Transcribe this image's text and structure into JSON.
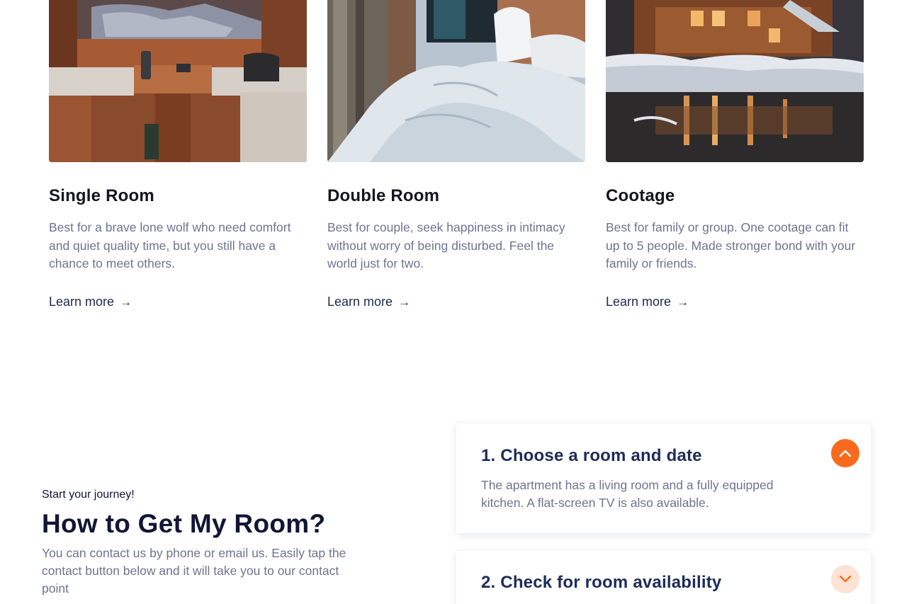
{
  "rooms": [
    {
      "title": "Single Room",
      "description": "Best for a brave lone wolf who need comfort and quiet quality time, but you still have a chance to meet others.",
      "link": "Learn more",
      "image_icon": "wooden-cabin-interior-photo"
    },
    {
      "title": "Double Room",
      "description": "Best for couple, seek happiness in intimacy without worry of being disturbed. Feel the world just for two.",
      "link": "Learn more",
      "image_icon": "white-bed-photo"
    },
    {
      "title": "Cootage",
      "description": "Best for family or group. One cootage can fit up to 5 people. Made stronger bond with your family or friends.",
      "link": "Learn more",
      "image_icon": "snowy-cottage-photo"
    }
  ],
  "journey": {
    "kicker": "Start your journey!",
    "title": "How to Get My Room?",
    "description": "You can contact us by phone or email us. Easily tap the contact button below and it will take you to our contact point"
  },
  "faq": [
    {
      "question": "1. Choose a room and date",
      "answer": "The apartment has a living room and a fully equipped kitchen. A flat-screen TV is also available.",
      "expanded": true,
      "icon": "chevron-up-icon"
    },
    {
      "question": "2. Check for room availability",
      "expanded": false,
      "icon": "chevron-down-icon"
    }
  ],
  "colors": {
    "accent": "#fb6a1c",
    "accent_light": "#fde3d4",
    "heading": "#111634",
    "body_text": "#6e7490"
  }
}
